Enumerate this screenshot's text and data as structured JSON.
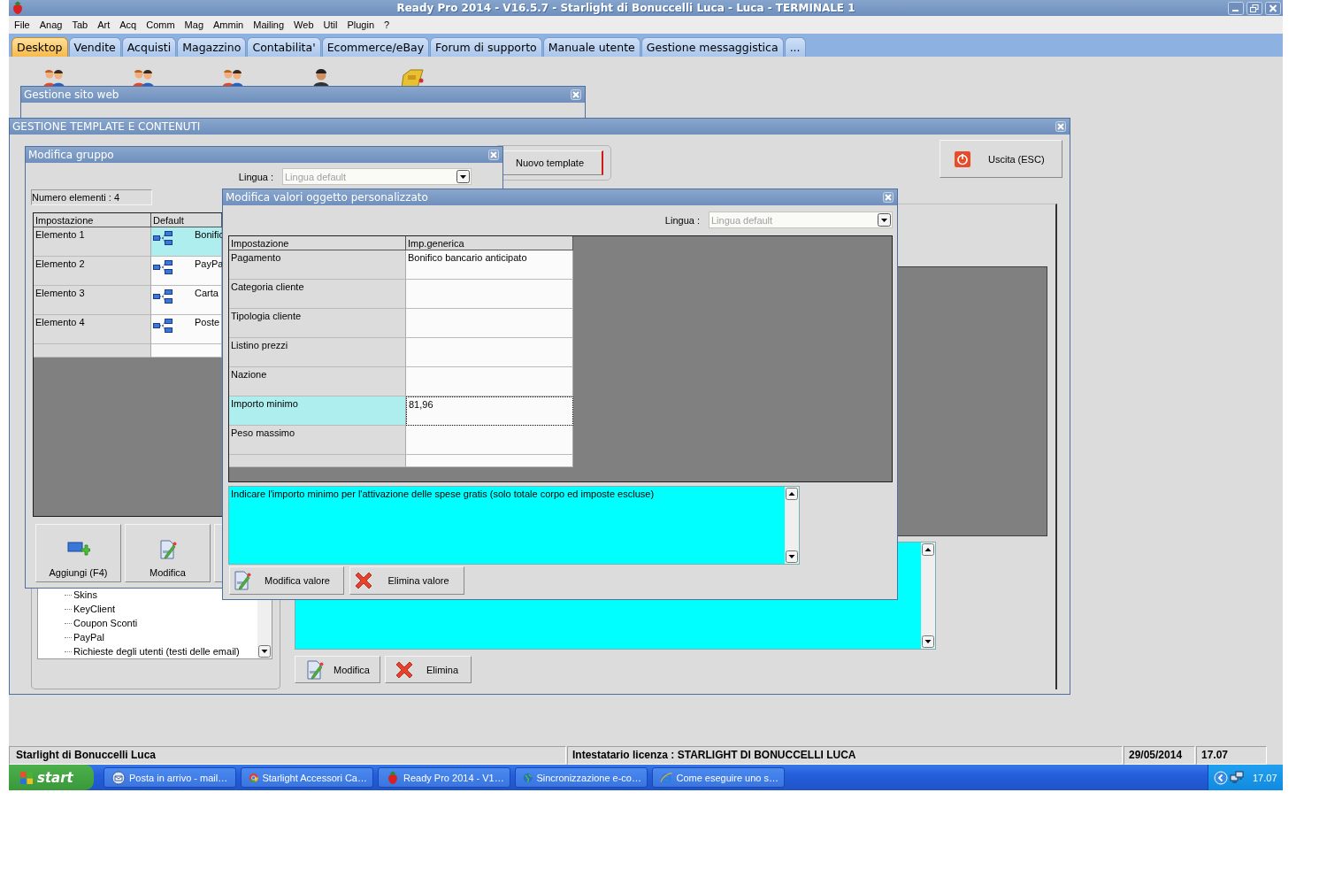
{
  "window": {
    "title": "Ready Pro 2014 - V16.5.7 - Starlight di Bonuccelli Luca - Luca - TERMINALE 1"
  },
  "menu": [
    "File",
    "Anag",
    "Tab",
    "Art",
    "Acq",
    "Comm",
    "Mag",
    "Ammin",
    "Mailing",
    "Web",
    "Util",
    "Plugin",
    "?"
  ],
  "tabs": [
    {
      "label": "Desktop",
      "selected": true
    },
    {
      "label": "Vendite",
      "selected": false
    },
    {
      "label": "Acquisti",
      "selected": false
    },
    {
      "label": "Magazzino",
      "selected": false
    },
    {
      "label": "Contabilita'",
      "selected": false
    },
    {
      "label": "Ecommerce/eBay",
      "selected": false
    },
    {
      "label": "Forum di supporto",
      "selected": false
    },
    {
      "label": "Manuale utente",
      "selected": false
    },
    {
      "label": "Gestione messaggistica",
      "selected": false
    },
    {
      "label": "...",
      "selected": false
    }
  ],
  "site_window": {
    "title": "Gestione sito web"
  },
  "template_window": {
    "title": "GESTIONE TEMPLATE E CONTENUTI",
    "new_button": "Nuovo template",
    "exit_button": "Uscita (ESC)",
    "tree_items": [
      "Skins",
      "KeyClient",
      "Coupon Sconti",
      "PayPal",
      "Richieste degli utenti (testi delle email)"
    ],
    "buttons": [
      {
        "label": "Modifica",
        "kind": "edit"
      },
      {
        "label": "Elimina",
        "kind": "delete"
      }
    ]
  },
  "group_dialog": {
    "title": "Modifica gruppo",
    "language_label": "Lingua :",
    "language": {
      "placeholder": "Lingua default"
    },
    "count": "Numero elementi : 4",
    "columns": [
      "Impostazione",
      "Default"
    ],
    "rows": [
      {
        "name": "Elemento 1",
        "value": "Bonific",
        "selected": true
      },
      {
        "name": "Elemento 2",
        "value": "PayPa",
        "selected": false
      },
      {
        "name": "Elemento 3",
        "value": "Carta",
        "selected": false
      },
      {
        "name": "Elemento 4",
        "value": "Poste",
        "selected": false
      }
    ],
    "buttons": [
      {
        "label": "Aggiungi (F4)",
        "kind": "add"
      },
      {
        "label": "Modifica",
        "kind": "edit"
      }
    ]
  },
  "values_dialog": {
    "title": "Modifica valori oggetto personalizzato",
    "language_label": "Lingua :",
    "language": {
      "placeholder": "Lingua default"
    },
    "columns": [
      "Impostazione",
      "Imp.generica"
    ],
    "rows": [
      {
        "name": "Pagamento",
        "value": "Bonifico bancario anticipato",
        "selected": false
      },
      {
        "name": "Categoria cliente",
        "selected": false
      },
      {
        "name": "Tipologia cliente",
        "selected": false
      },
      {
        "name": "Listino prezzi",
        "selected": false
      },
      {
        "name": "Nazione",
        "selected": false
      },
      {
        "name": "Importo minimo",
        "value": "81,96",
        "selected": true
      },
      {
        "name": "Peso massimo",
        "selected": false
      }
    ],
    "description": "Indicare l'importo minimo per l'attivazione delle spese gratis (solo totale corpo ed imposte escluse)",
    "buttons": [
      {
        "label": "Modifica valore",
        "kind": "edit"
      },
      {
        "label": "Elimina valore",
        "kind": "delete"
      }
    ]
  },
  "status_bar": [
    "Starlight di Bonuccelli Luca",
    "Intestatario licenza : STARLIGHT DI BONUCCELLI LUCA",
    "29/05/2014",
    "17.07"
  ],
  "taskbar": {
    "start": "start",
    "tasks": [
      {
        "label": "Posta in arrivo - mail…",
        "kind": "mail"
      },
      {
        "label": "Starlight Accessori Ca…",
        "kind": "browser"
      },
      {
        "label": "Ready Pro 2014 - V1…",
        "kind": "app"
      },
      {
        "label": "Sincronizzazione e-co…",
        "kind": "globe"
      },
      {
        "label": "Come eseguire uno s…",
        "kind": "web"
      }
    ],
    "clock": "17.07"
  }
}
